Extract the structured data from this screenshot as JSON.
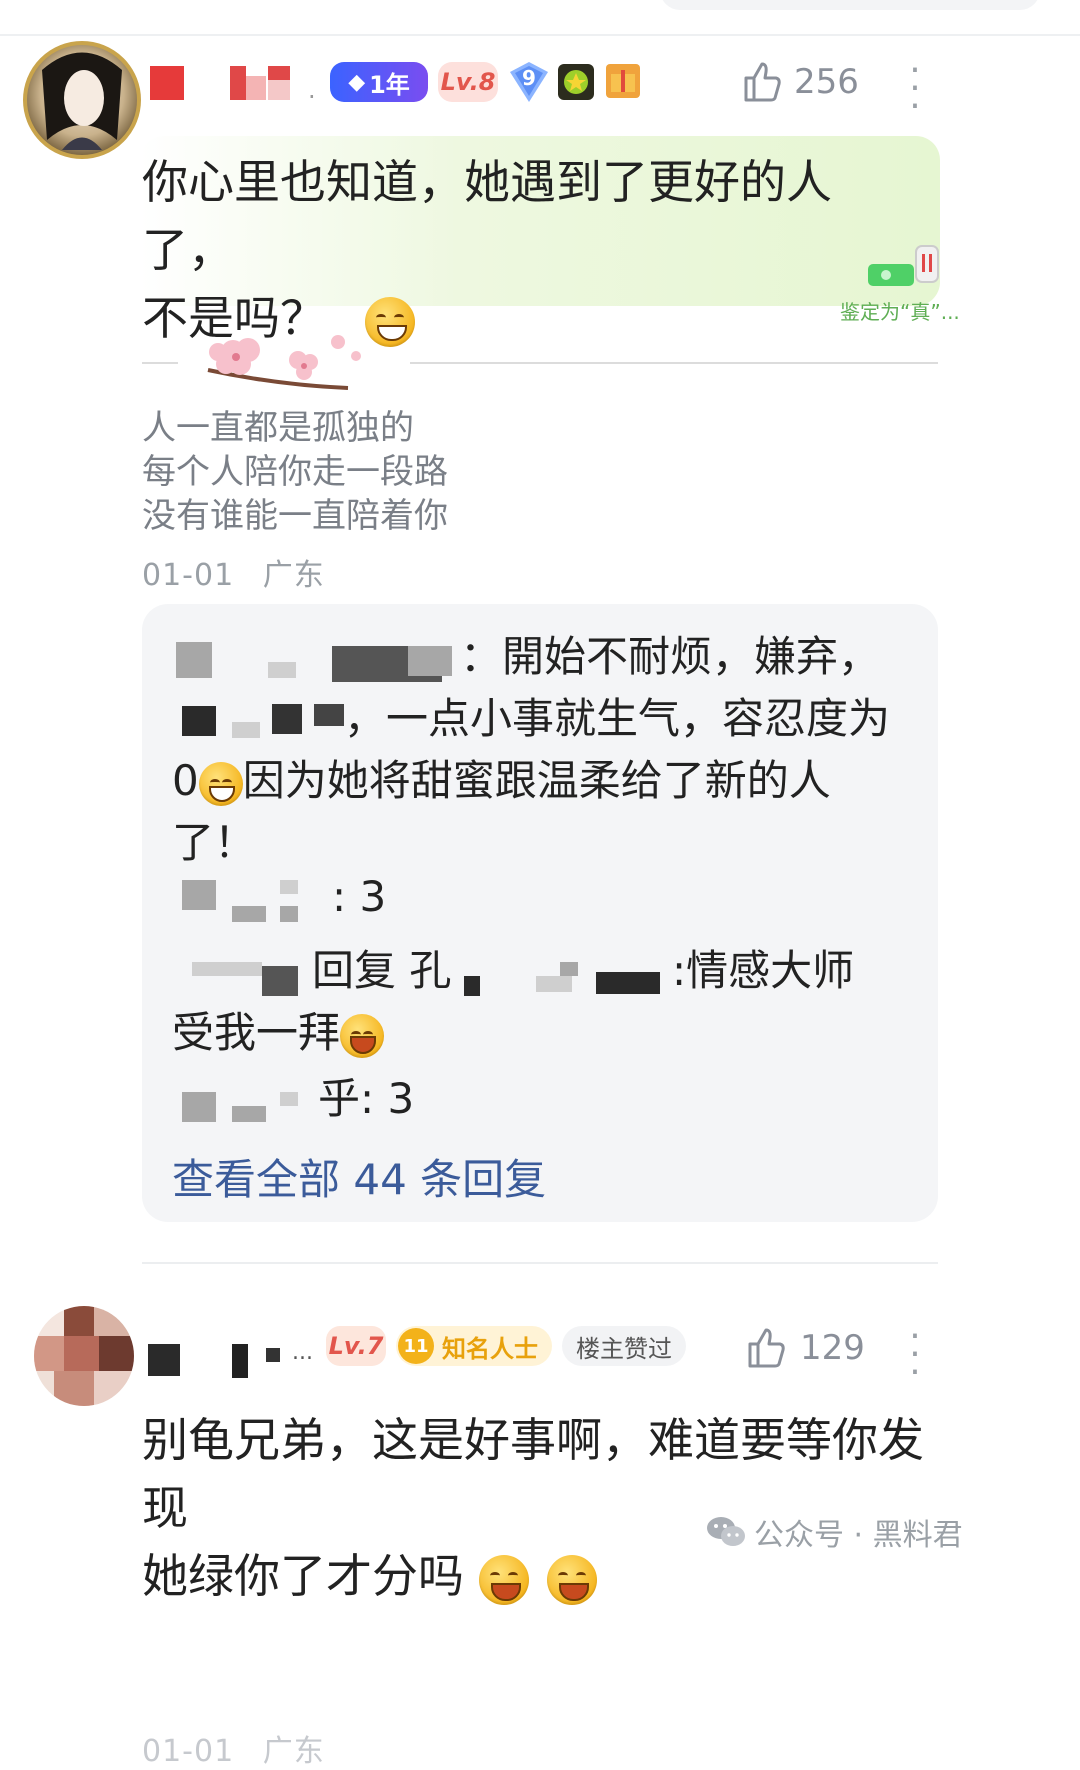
{
  "comment1": {
    "badges": {
      "years": "1年",
      "level": "Lv.8",
      "shield_num": "9"
    },
    "likes": "256",
    "text_line1": "你心里也知道，她遇到了更好的人了，",
    "text_line2": "不是吗？",
    "verify_label": "鉴定为“真”...",
    "signature": [
      "人一直都是孤独的",
      "每个人陪你走一段路",
      "没有谁能一直陪着你"
    ],
    "date": "01-01",
    "location": "广东"
  },
  "replies": {
    "r1_part1": "開始不耐烦，嫌弃，",
    "r1_part2": "，一点小事就生气，容忍度为",
    "r1_zero": "0",
    "r1_part3": "因为她将甜蜜跟温柔给了新的人",
    "r1_part4": "了！",
    "r2_suffix": ": 3",
    "r3_reply_word": "回复 孔",
    "r3_text": ":情感大师",
    "r3_text2": "受我一拜",
    "r4_suffix": "乎: 3",
    "view_all": "查看全部 44 条回复"
  },
  "comment2": {
    "level": "Lv.7",
    "fan_num": "11",
    "fan_title": "知名人士",
    "owner_liked": "楼主赞过",
    "likes": "129",
    "ellipsis": "...",
    "text_line1": "别龟兄弟，这是好事啊，难道要等你发现",
    "text_line2": "她绿你了才分吗",
    "date_partial": "01-01",
    "location_partial": "广东"
  },
  "watermark": {
    "label": "公众号 · 黑料君"
  },
  "colors": {
    "link": "#3b5b9a",
    "like_grey": "#8a8f99",
    "badge_blue": "#2f6bff",
    "level_red": "#e2564c",
    "fan_gold": "#e8a10c"
  },
  "icons": [
    "thumbs-up-icon",
    "more-vertical-icon",
    "wechat-icon",
    "diamond-icon",
    "shield-icon",
    "flower-icon"
  ]
}
